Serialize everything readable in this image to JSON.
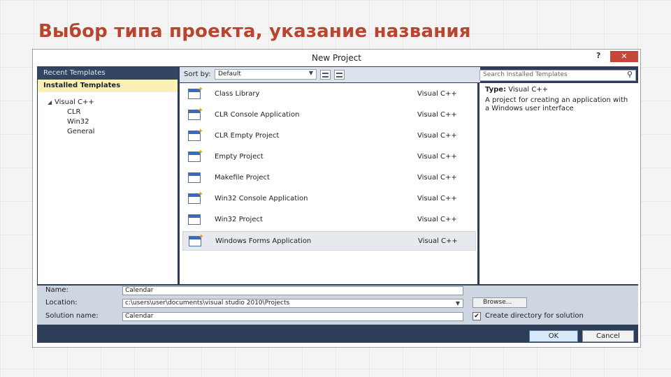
{
  "slide": {
    "title": "Выбор типа проекта, указание названия"
  },
  "dialog": {
    "title": "New Project",
    "help_label": "?",
    "close_label": "✕",
    "sidebar": {
      "recent": "Recent Templates",
      "installed": "Installed Templates",
      "tree": {
        "root": "Visual C++",
        "children": [
          "CLR",
          "Win32",
          "General"
        ]
      }
    },
    "toolbar": {
      "sort_label": "Sort by:",
      "sort_value": "Default"
    },
    "search": {
      "placeholder": "Search Installed Templates"
    },
    "templates": [
      {
        "name": "Class Library",
        "lang": "Visual C++"
      },
      {
        "name": "CLR Console Application",
        "lang": "Visual C++"
      },
      {
        "name": "CLR Empty Project",
        "lang": "Visual C++"
      },
      {
        "name": "Empty Project",
        "lang": "Visual C++"
      },
      {
        "name": "Makefile Project",
        "lang": "Visual C++"
      },
      {
        "name": "Win32 Console Application",
        "lang": "Visual C++"
      },
      {
        "name": "Win32 Project",
        "lang": "Visual C++"
      },
      {
        "name": "Windows Forms Application",
        "lang": "Visual C++"
      }
    ],
    "selected_index": 7,
    "details": {
      "type_label": "Type:",
      "type_value": "Visual C++",
      "description": "A project for creating an application with a Windows user interface"
    },
    "form": {
      "name_label": "Name:",
      "name_value": "Calendar",
      "location_label": "Location:",
      "location_value": "c:\\users\\user\\documents\\visual studio 2010\\Projects",
      "solution_label": "Solution name:",
      "solution_value": "Calendar",
      "browse_label": "Browse...",
      "create_dir_label": "Create directory for solution",
      "create_dir_checked": true
    },
    "buttons": {
      "ok": "OK",
      "cancel": "Cancel"
    }
  }
}
